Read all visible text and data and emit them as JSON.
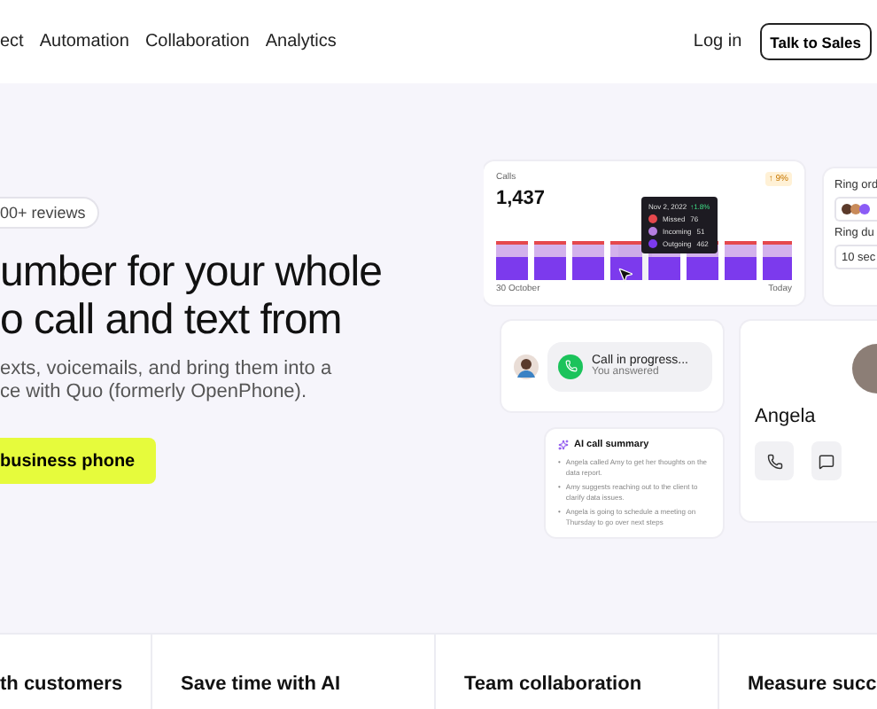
{
  "nav": {
    "links": [
      "ect",
      "Automation",
      "Collaboration",
      "Analytics"
    ],
    "login": "Log in",
    "cta": "Talk to Sales"
  },
  "hero": {
    "badge": "00+ reviews",
    "headline": [
      "umber for your whole",
      "o call and text from"
    ],
    "body": [
      "exts, voicemails, and bring them into a",
      "ce with Quo (formerly OpenPhone)."
    ],
    "button": "business phone"
  },
  "calls_card": {
    "title": "Calls",
    "total": "1,437",
    "trend": "↑ 9%",
    "start_label": "30 October",
    "end_label": "Today",
    "tooltip": {
      "date": "Nov 2, 2022",
      "change": "↑1.8%",
      "rows": [
        {
          "label": "Missed",
          "value": "76",
          "color": "#e5484d"
        },
        {
          "label": "Incoming",
          "value": "51",
          "color": "#b57ee0"
        },
        {
          "label": "Outgoing",
          "value": "462",
          "color": "#7c3aed"
        }
      ]
    }
  },
  "ring_card": {
    "order_label": "Ring ord",
    "duration_label": "Ring du",
    "duration_value": "10 sec"
  },
  "call_card": {
    "status": "Call in progress...",
    "detail": "You answered"
  },
  "summary_card": {
    "title": "AI call summary",
    "bullet": "•",
    "items": [
      "Angela called Amy to get her thoughts on the data report.",
      "Amy suggests reaching out to the client to clarify data issues.",
      "Angela is going to schedule a meeting on Thursday to go over next steps"
    ]
  },
  "contact_card": {
    "name": "Angela"
  },
  "features": [
    "th customers",
    "Save time with AI",
    "Team collaboration",
    "Measure succ"
  ]
}
